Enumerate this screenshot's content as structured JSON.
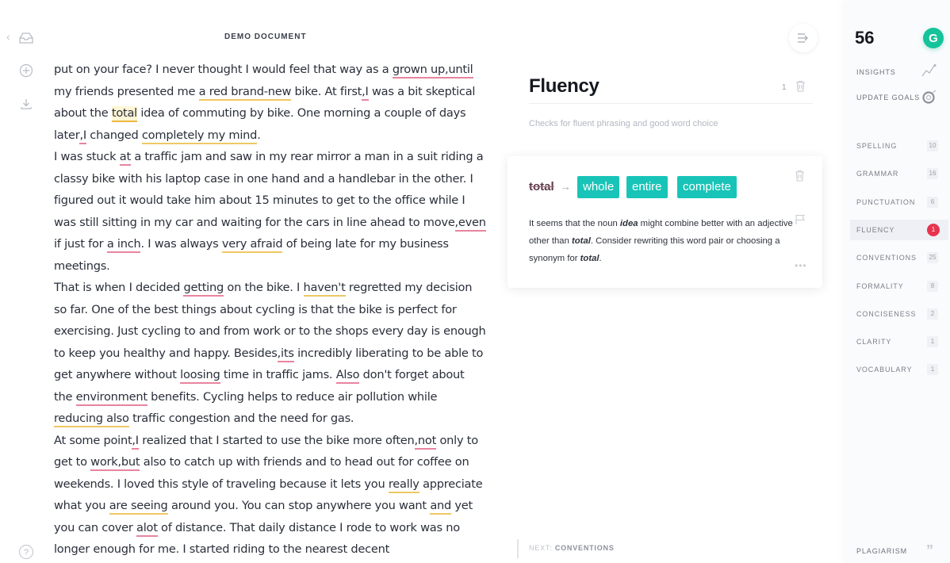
{
  "document": {
    "title": "DEMO DOCUMENT",
    "paragraphs": [
      [
        {
          "t": "put on your face? I never thought I would feel that way as a "
        },
        {
          "t": "grown up,until",
          "u": "red"
        },
        {
          "t": " my friends presented me "
        },
        {
          "t": "a red brand-new",
          "u": "yel"
        },
        {
          "t": " bike. At first"
        },
        {
          "t": ",I",
          "u": "red"
        },
        {
          "t": " was a bit skeptical about the "
        },
        {
          "t": "total",
          "u": "sel"
        },
        {
          "t": " idea of commuting by bike. One morning a couple of days later"
        },
        {
          "t": ",I",
          "u": "red"
        },
        {
          "t": " changed "
        },
        {
          "t": "completely my mind",
          "u": "yel"
        },
        {
          "t": "."
        }
      ],
      [
        {
          "t": "I was stuck "
        },
        {
          "t": "at",
          "u": "red"
        },
        {
          "t": " a traffic jam and saw in my rear mirror a man in a suit riding a classy bike with his laptop case in one hand and a handlebar in the other. I figured out it would take him about 15 minutes to get to the office while I was still sitting in my car and waiting for the cars in line ahead to move"
        },
        {
          "t": ",even",
          "u": "red"
        },
        {
          "t": " if just for "
        },
        {
          "t": "a inch",
          "u": "red"
        },
        {
          "t": ". I was always "
        },
        {
          "t": "very afraid",
          "u": "yel"
        },
        {
          "t": " of being late for my business meetings."
        }
      ],
      [
        {
          "t": "That is when I decided "
        },
        {
          "t": "getting",
          "u": "red"
        },
        {
          "t": " on the bike. I "
        },
        {
          "t": "haven't",
          "u": "yel"
        },
        {
          "t": " regretted my decision so far. One of the best things about cycling is that the bike is perfect for exercising. Just cycling to and from work or to the shops every day is enough to keep you healthy and happy. Besides"
        },
        {
          "t": ",its",
          "u": "red"
        },
        {
          "t": " incredibly liberating to be able to get anywhere without "
        },
        {
          "t": "loosing",
          "u": "red"
        },
        {
          "t": " time in traffic jams. "
        },
        {
          "t": "Also",
          "u": "red"
        },
        {
          "t": " don't forget about the "
        },
        {
          "t": "environment",
          "u": "red"
        },
        {
          "t": " benefits. Cycling helps to reduce air pollution while "
        },
        {
          "t": "reducing also",
          "u": "yel"
        },
        {
          "t": " traffic congestion and the need for gas."
        }
      ],
      [
        {
          "t": "At some point"
        },
        {
          "t": ",I",
          "u": "red"
        },
        {
          "t": " realized that I started to use the bike more often"
        },
        {
          "t": ",not",
          "u": "red"
        },
        {
          "t": " only to get to "
        },
        {
          "t": "work,but",
          "u": "red"
        },
        {
          "t": " also to catch up with friends and to head out for coffee on weekends. I loved this style of traveling because it lets you "
        },
        {
          "t": "really",
          "u": "yel"
        },
        {
          "t": " appreciate what you "
        },
        {
          "t": "are seeing",
          "u": "yel"
        },
        {
          "t": " around you. You can stop anywhere you want "
        },
        {
          "t": "and",
          "u": "yel"
        },
        {
          "t": " yet you can cover "
        },
        {
          "t": "alot",
          "u": "red"
        },
        {
          "t": " of distance. That daily distance I rode to work was no longer enough for me. I started riding to the nearest decent"
        }
      ]
    ]
  },
  "left_rail": {
    "icons": [
      "back-chevron",
      "documents-icon",
      "add-icon",
      "download-icon",
      "help-icon"
    ]
  },
  "panel": {
    "category_title": "Fluency",
    "category_count": "1",
    "category_description": "Checks for fluent phrasing and good word choice",
    "card": {
      "original": "total",
      "suggestions": [
        "whole",
        "entire",
        "complete"
      ],
      "explanation_parts": [
        {
          "t": "It seems that the noun "
        },
        {
          "t": "idea",
          "s": "bi"
        },
        {
          "t": " might combine better with an adjective other than "
        },
        {
          "t": "total",
          "s": "bi"
        },
        {
          "t": ". Consider rewriting this word pair or choosing a synonym for "
        },
        {
          "t": "total",
          "s": "bi"
        },
        {
          "t": "."
        }
      ],
      "more_label": "•••"
    },
    "next_prefix": "NEXT:",
    "next_category": "CONVENTIONS"
  },
  "sidebar": {
    "score": "56",
    "logo_letter": "G",
    "insights_label": "INSIGHTS",
    "update_goals_label": "UPDATE GOALS",
    "categories": [
      {
        "label": "SPELLING",
        "count": "10",
        "active": false
      },
      {
        "label": "GRAMMAR",
        "count": "16",
        "active": false
      },
      {
        "label": "PUNCTUATION",
        "count": "6",
        "active": false
      },
      {
        "label": "FLUENCY",
        "count": "1",
        "active": true
      },
      {
        "label": "CONVENTIONS",
        "count": "25",
        "active": false
      },
      {
        "label": "FORMALITY",
        "count": "8",
        "active": false
      },
      {
        "label": "CONCISENESS",
        "count": "2",
        "active": false
      },
      {
        "label": "CLARITY",
        "count": "1",
        "active": false
      },
      {
        "label": "VOCABULARY",
        "count": "1",
        "active": false
      }
    ],
    "plagiarism_label": "PLAGIARISM"
  },
  "colors": {
    "accent": "#15c39a",
    "suggestion": "#18c4b7",
    "alert": "#e8334f",
    "correctness_underline": "#e8849e",
    "clarity_underline": "#eec864"
  }
}
